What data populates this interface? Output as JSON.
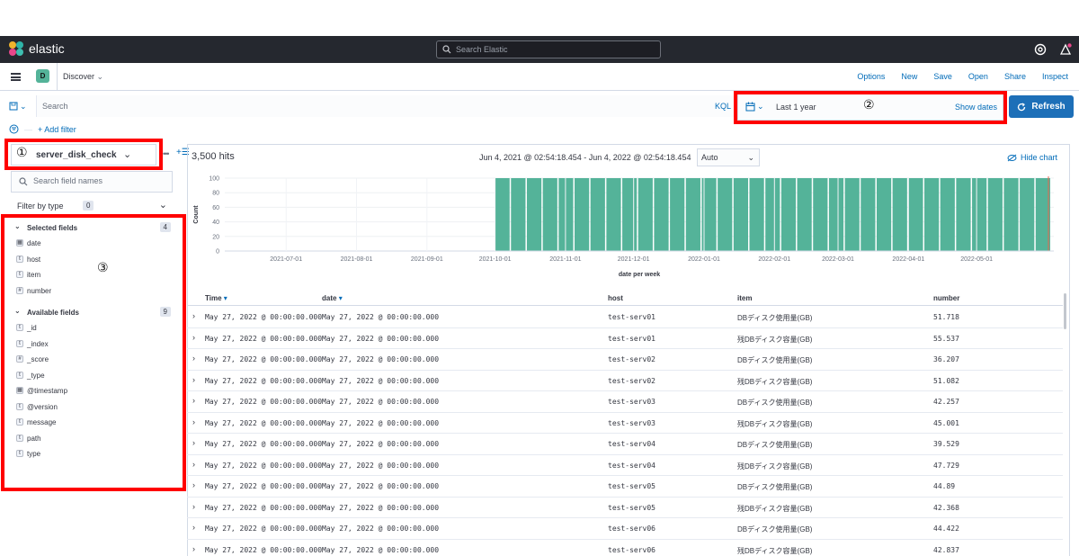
{
  "topbar": {
    "brand": "elastic",
    "search_placeholder": "Search Elastic",
    "logo_colors": [
      "#f0b42d",
      "#2fb4a9",
      "#e9478b",
      "#3ebeb0"
    ]
  },
  "navbar": {
    "space_initial": "D",
    "space_color": "#54b399",
    "breadcrumb": "Discover",
    "links": [
      "Options",
      "New",
      "Save",
      "Open",
      "Share",
      "Inspect"
    ]
  },
  "query": {
    "placeholder": "Search",
    "language": "KQL",
    "date_range": "Last 1 year",
    "show_dates": "Show dates",
    "refresh_label": "Refresh",
    "add_filter": "+ Add filter"
  },
  "sidebar": {
    "index_pattern": "server_disk_check",
    "field_search_placeholder": "Search field names",
    "filter_by_type": "Filter by type",
    "filter_by_type_count": "0",
    "selected_title": "Selected fields",
    "selected_count": "4",
    "selected_fields": [
      {
        "name": "date",
        "type": "date"
      },
      {
        "name": "host",
        "type": "string"
      },
      {
        "name": "item",
        "type": "string"
      },
      {
        "name": "number",
        "type": "number"
      }
    ],
    "available_title": "Available fields",
    "available_count": "9",
    "available_fields": [
      {
        "name": "_id",
        "type": "string"
      },
      {
        "name": "_index",
        "type": "string"
      },
      {
        "name": "_score",
        "type": "number"
      },
      {
        "name": "_type",
        "type": "string"
      },
      {
        "name": "@timestamp",
        "type": "date"
      },
      {
        "name": "@version",
        "type": "string"
      },
      {
        "name": "message",
        "type": "string"
      },
      {
        "name": "path",
        "type": "string"
      },
      {
        "name": "type",
        "type": "string"
      }
    ]
  },
  "annotations": {
    "one": "①",
    "two": "②",
    "three": "③",
    "color": "#ff0000"
  },
  "main": {
    "hits": "3,500 hits",
    "time_range": "Jun 4, 2021 @ 02:54:18.454 - Jun 4, 2022 @ 02:54:18.454",
    "interval": "Auto",
    "hide_chart": "Hide chart"
  },
  "chart_data": {
    "type": "bar",
    "ylabel": "Count",
    "xlabel": "date per week",
    "ylim": [
      0,
      100
    ],
    "y_ticks": [
      0,
      20,
      40,
      60,
      80,
      100
    ],
    "x_tick_labels": [
      "2021-07-01",
      "2021-08-01",
      "2021-09-01",
      "2021-10-01",
      "2021-11-01",
      "2021-12-01",
      "2022-01-01",
      "2022-02-01",
      "2022-03-01",
      "2022-04-01",
      "2022-05-01"
    ],
    "bar_color": "#54b399",
    "now_marker_color": "#e7664c",
    "bars": {
      "weeks": 35,
      "value_per_week": 100,
      "first_week": "2021-10-01",
      "last_week": "2022-05-27"
    }
  },
  "table": {
    "columns": [
      "Time",
      "date",
      "host",
      "item",
      "number"
    ],
    "rows": [
      {
        "time": "May 27, 2022 @ 00:00:00.000",
        "date": "May 27, 2022 @ 00:00:00.000",
        "host": "test-serv01",
        "item": "DBディスク使用量(GB)",
        "number": "51.718"
      },
      {
        "time": "May 27, 2022 @ 00:00:00.000",
        "date": "May 27, 2022 @ 00:00:00.000",
        "host": "test-serv01",
        "item": "残DBディスク容量(GB)",
        "number": "55.537"
      },
      {
        "time": "May 27, 2022 @ 00:00:00.000",
        "date": "May 27, 2022 @ 00:00:00.000",
        "host": "test-serv02",
        "item": "DBディスク使用量(GB)",
        "number": "36.207"
      },
      {
        "time": "May 27, 2022 @ 00:00:00.000",
        "date": "May 27, 2022 @ 00:00:00.000",
        "host": "test-serv02",
        "item": "残DBディスク容量(GB)",
        "number": "51.082"
      },
      {
        "time": "May 27, 2022 @ 00:00:00.000",
        "date": "May 27, 2022 @ 00:00:00.000",
        "host": "test-serv03",
        "item": "DBディスク使用量(GB)",
        "number": "42.257"
      },
      {
        "time": "May 27, 2022 @ 00:00:00.000",
        "date": "May 27, 2022 @ 00:00:00.000",
        "host": "test-serv03",
        "item": "残DBディスク容量(GB)",
        "number": "45.001"
      },
      {
        "time": "May 27, 2022 @ 00:00:00.000",
        "date": "May 27, 2022 @ 00:00:00.000",
        "host": "test-serv04",
        "item": "DBディスク使用量(GB)",
        "number": "39.529"
      },
      {
        "time": "May 27, 2022 @ 00:00:00.000",
        "date": "May 27, 2022 @ 00:00:00.000",
        "host": "test-serv04",
        "item": "残DBディスク容量(GB)",
        "number": "47.729"
      },
      {
        "time": "May 27, 2022 @ 00:00:00.000",
        "date": "May 27, 2022 @ 00:00:00.000",
        "host": "test-serv05",
        "item": "DBディスク使用量(GB)",
        "number": "44.89"
      },
      {
        "time": "May 27, 2022 @ 00:00:00.000",
        "date": "May 27, 2022 @ 00:00:00.000",
        "host": "test-serv05",
        "item": "残DBディスク容量(GB)",
        "number": "42.368"
      },
      {
        "time": "May 27, 2022 @ 00:00:00.000",
        "date": "May 27, 2022 @ 00:00:00.000",
        "host": "test-serv06",
        "item": "DBディスク使用量(GB)",
        "number": "44.422"
      },
      {
        "time": "May 27, 2022 @ 00:00:00.000",
        "date": "May 27, 2022 @ 00:00:00.000",
        "host": "test-serv06",
        "item": "残DBディスク容量(GB)",
        "number": "42.837"
      }
    ]
  }
}
